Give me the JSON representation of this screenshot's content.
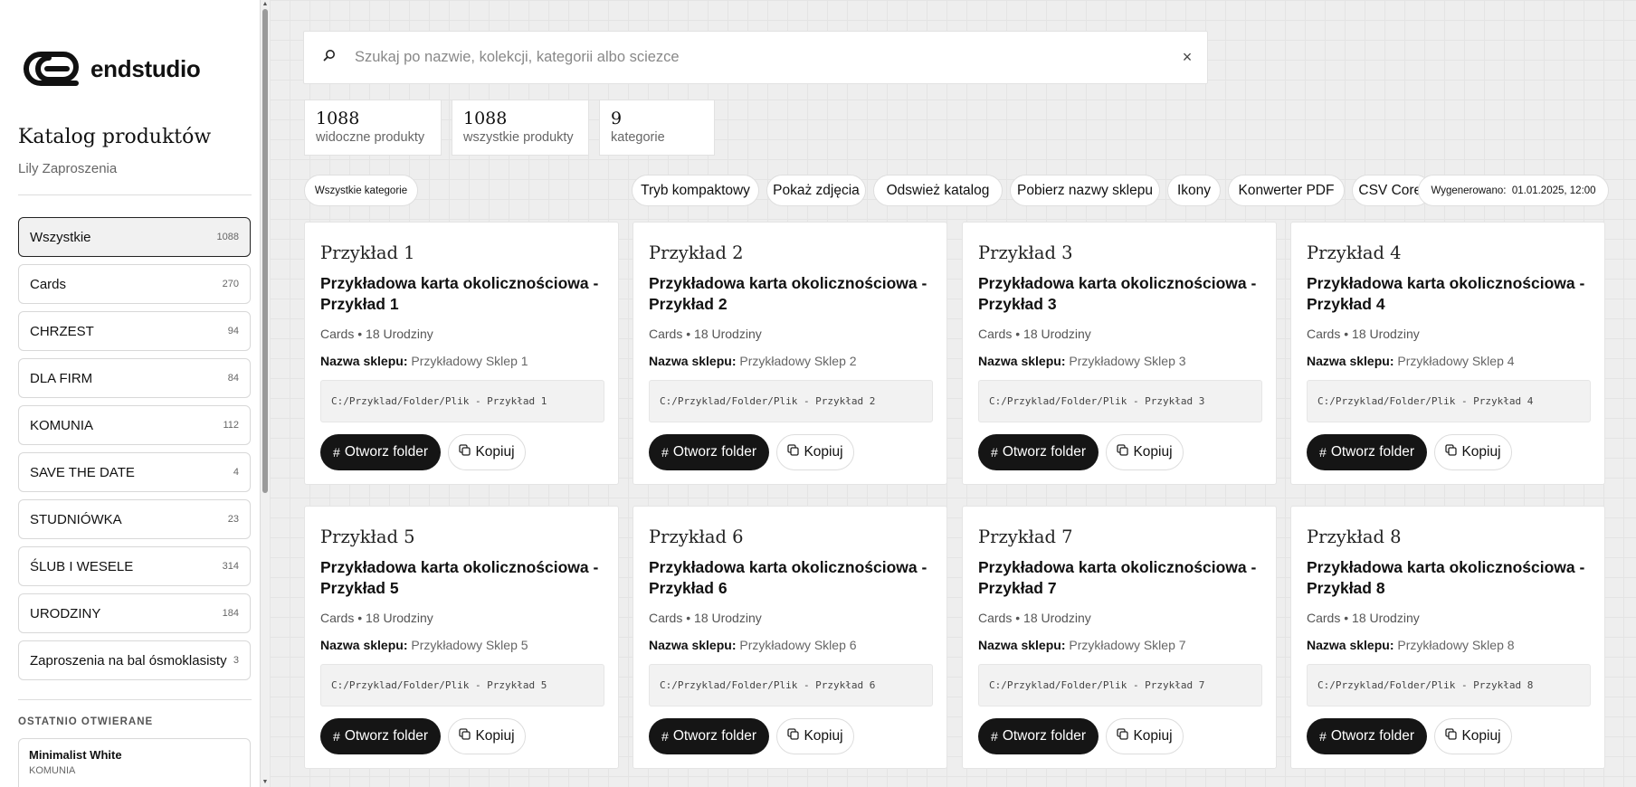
{
  "brand": {
    "name": "endstudio"
  },
  "sidebar": {
    "title": "Katalog produktów",
    "subtitle": "Lily Zaproszenia",
    "categories": [
      {
        "label": "Wszystkie",
        "count": "1088"
      },
      {
        "label": "Cards",
        "count": "270"
      },
      {
        "label": "CHRZEST",
        "count": "94"
      },
      {
        "label": "DLA FIRM",
        "count": "84"
      },
      {
        "label": "KOMUNIA",
        "count": "112"
      },
      {
        "label": "SAVE THE DATE",
        "count": "4"
      },
      {
        "label": "STUDNIÓWKA",
        "count": "23"
      },
      {
        "label": "ŚLUB I WESELE",
        "count": "314"
      },
      {
        "label": "URODZINY",
        "count": "184"
      },
      {
        "label": "Zaproszenia na bal ósmoklasisty",
        "count": "3"
      }
    ],
    "recent_heading": "OSTATNIO OTWIERANE",
    "recent": [
      {
        "title": "Minimalist White",
        "category": "KOMUNIA"
      }
    ]
  },
  "search": {
    "placeholder": "Szukaj po nazwie, kolekcji, kategorii albo sciezce",
    "value": ""
  },
  "stats": [
    {
      "value": "1088",
      "label": "widoczne produkty"
    },
    {
      "value": "1088",
      "label": "wszystkie produkty"
    },
    {
      "value": "9",
      "label": "kategorie"
    }
  ],
  "toolbar": {
    "filter_label": "Wszystkie kategorie",
    "buttons": [
      "Tryb kompaktowy",
      "Pokaż zdjęcia",
      "Odswież katalog",
      "Pobierz nazwy sklepu",
      "Ikony",
      "Konwerter PDF",
      "CSV Corel"
    ],
    "generated_label": "Wygenerowano:",
    "generated_value": "01.01.2025, 12:00"
  },
  "shop_label": "Nazwa sklepu:",
  "open_label": "Otworz folder",
  "copy_label": "Kopiuj",
  "products": [
    {
      "title": "Przykład 1",
      "name": "Przykładowa karta okolicznościowa - Przykład 1",
      "category": "Cards",
      "collection": "• 18 Urodziny",
      "shop": "Przykładowy Sklep 1",
      "path": "C:/Przyklad/Folder/Plik - Przykład 1"
    },
    {
      "title": "Przykład 2",
      "name": "Przykładowa karta okolicznościowa - Przykład 2",
      "category": "Cards",
      "collection": "• 18 Urodziny",
      "shop": "Przykładowy Sklep 2",
      "path": "C:/Przyklad/Folder/Plik - Przykład 2"
    },
    {
      "title": "Przykład 3",
      "name": "Przykładowa karta okolicznościowa - Przykład 3",
      "category": "Cards",
      "collection": "• 18 Urodziny",
      "shop": "Przykładowy Sklep 3",
      "path": "C:/Przyklad/Folder/Plik - Przykład 3"
    },
    {
      "title": "Przykład 4",
      "name": "Przykładowa karta okolicznościowa - Przykład 4",
      "category": "Cards",
      "collection": "• 18 Urodziny",
      "shop": "Przykładowy Sklep 4",
      "path": "C:/Przyklad/Folder/Plik - Przykład 4"
    },
    {
      "title": "Przykład 5",
      "name": "Przykładowa karta okolicznościowa - Przykład 5",
      "category": "Cards",
      "collection": "• 18 Urodziny",
      "shop": "Przykładowy Sklep 5",
      "path": "C:/Przyklad/Folder/Plik - Przykład 5"
    },
    {
      "title": "Przykład 6",
      "name": "Przykładowa karta okolicznościowa - Przykład 6",
      "category": "Cards",
      "collection": "• 18 Urodziny",
      "shop": "Przykładowy Sklep 6",
      "path": "C:/Przyklad/Folder/Plik - Przykład 6"
    },
    {
      "title": "Przykład 7",
      "name": "Przykładowa karta okolicznościowa - Przykład 7",
      "category": "Cards",
      "collection": "• 18 Urodziny",
      "shop": "Przykładowy Sklep 7",
      "path": "C:/Przyklad/Folder/Plik - Przykład 7"
    },
    {
      "title": "Przykład 8",
      "name": "Przykładowa karta okolicznościowa - Przykład 8",
      "category": "Cards",
      "collection": "• 18 Urodziny",
      "shop": "Przykładowy Sklep 8",
      "path": "C:/Przyklad/Folder/Plik - Przykład 8"
    }
  ]
}
